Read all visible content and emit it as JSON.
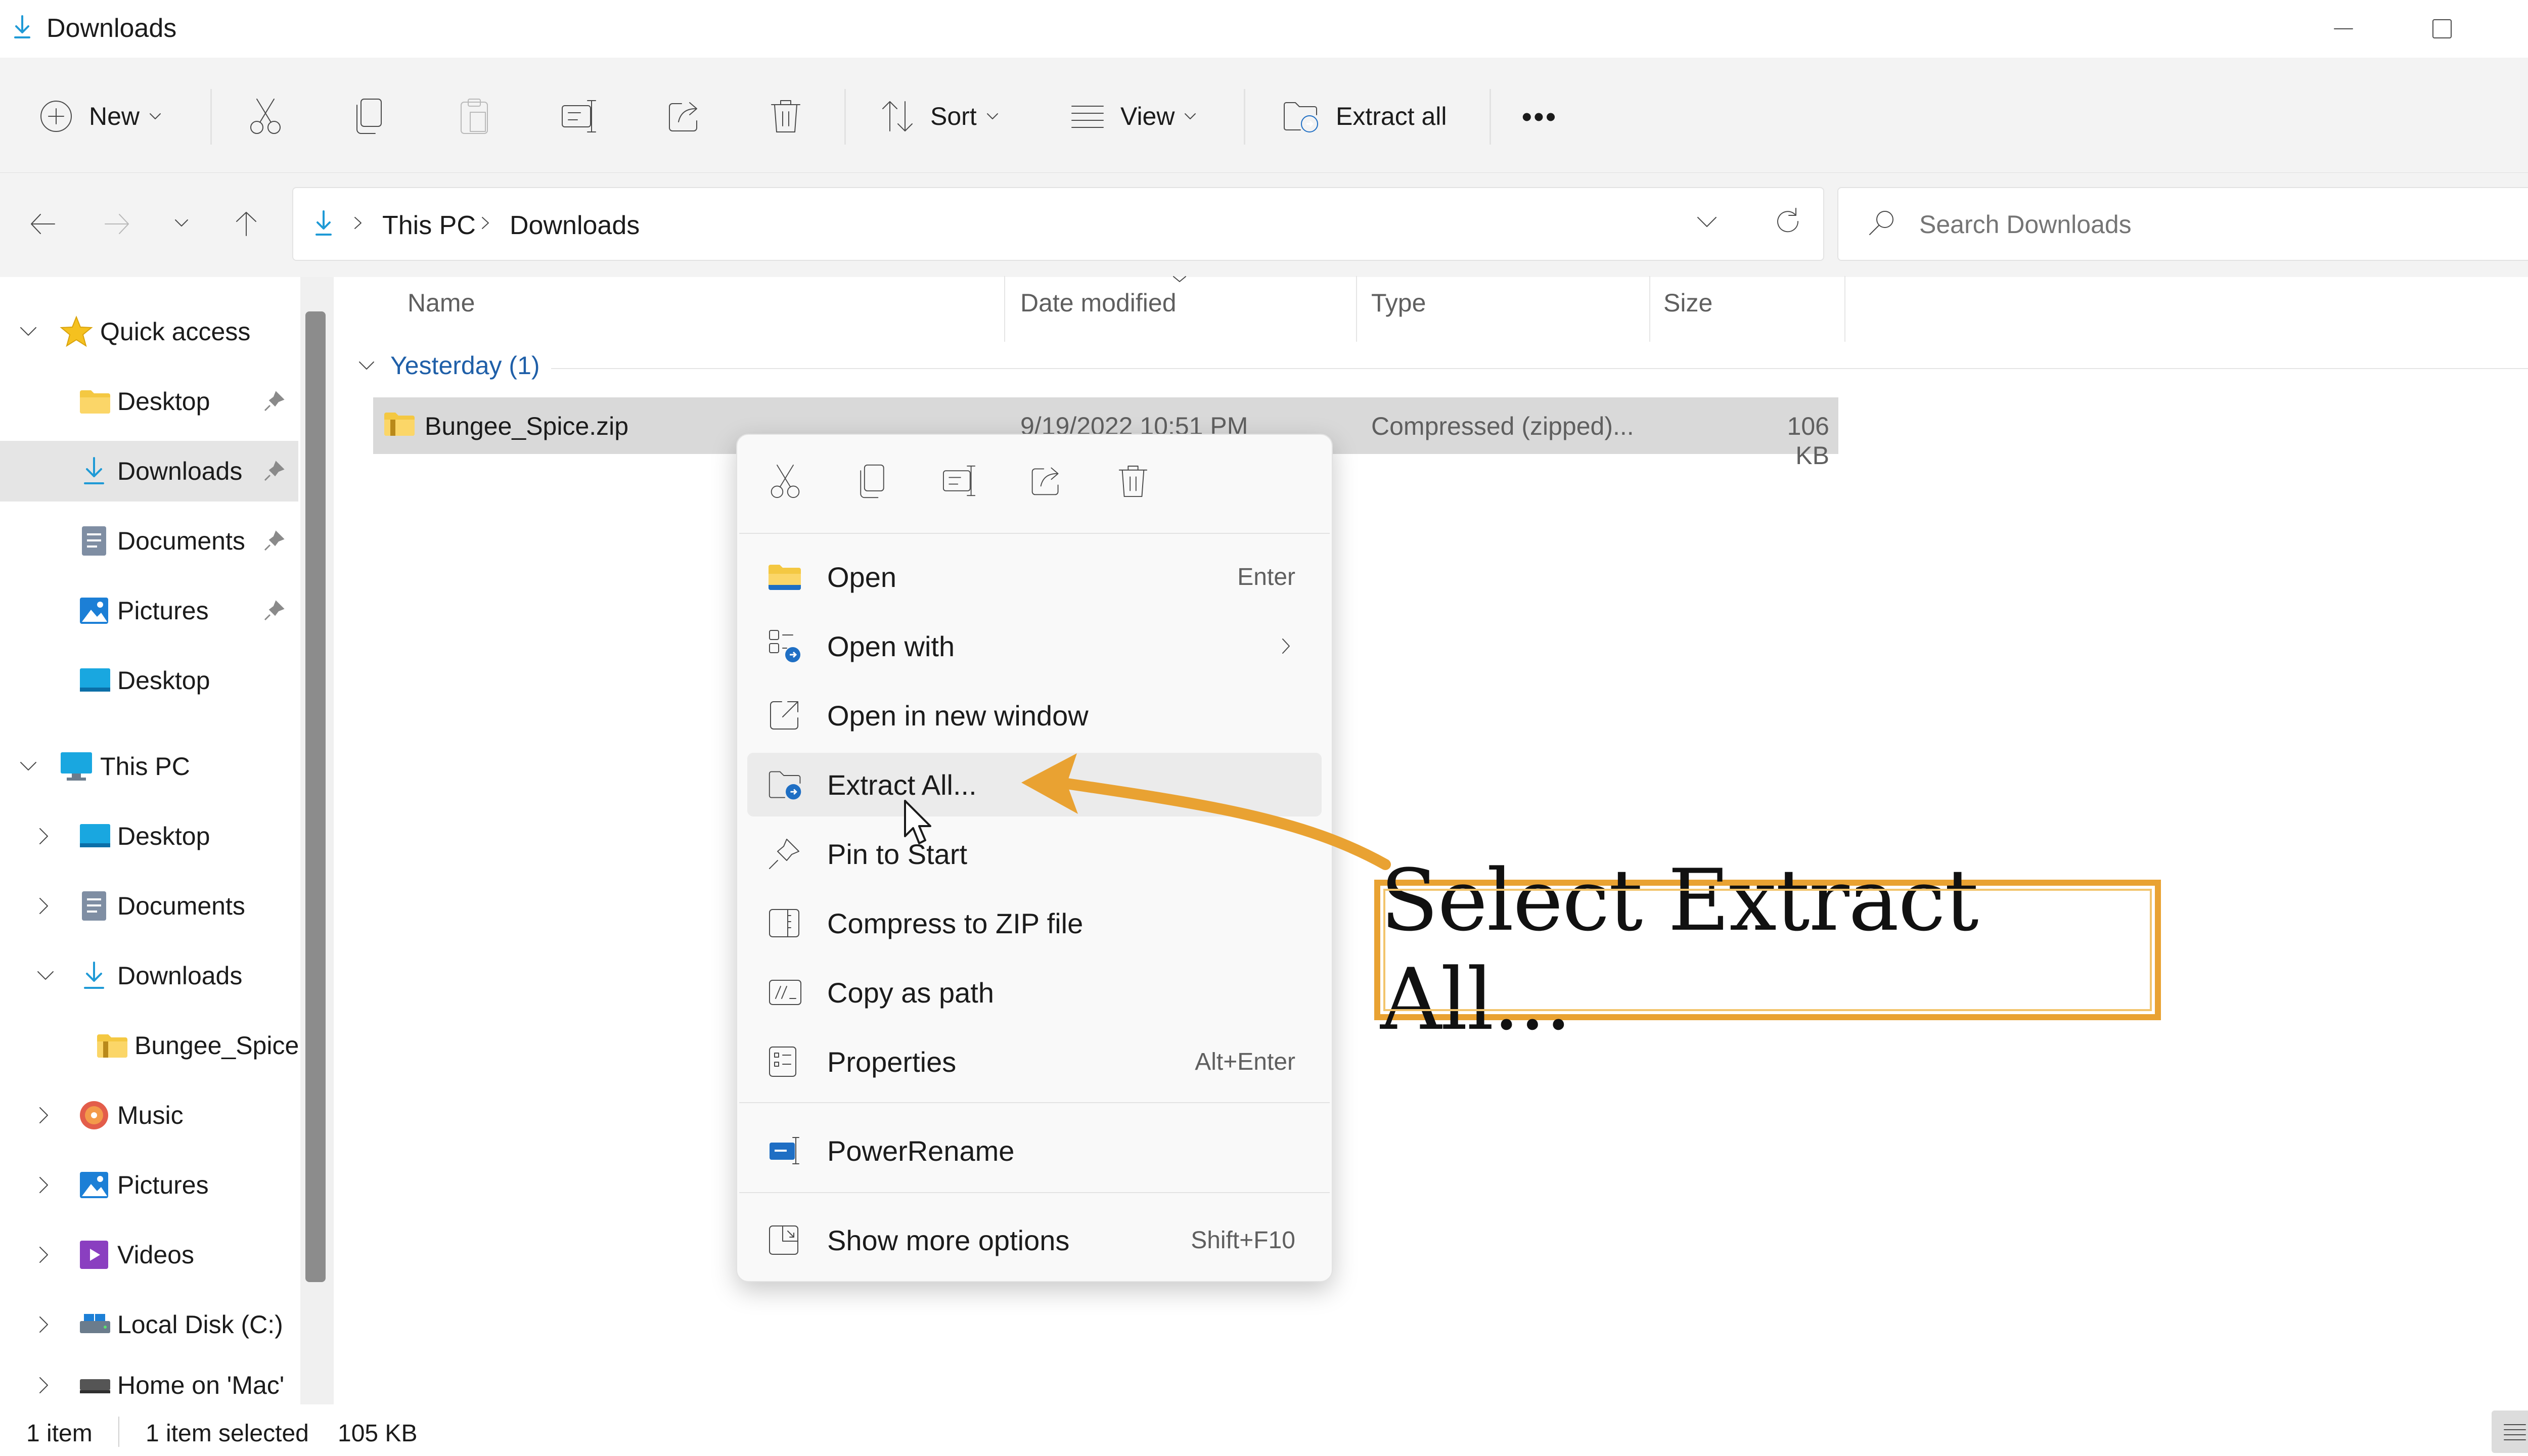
{
  "window": {
    "title": "Downloads"
  },
  "toolbar": {
    "new_label": "New",
    "sort_label": "Sort",
    "view_label": "View",
    "extract_all_label": "Extract all",
    "more_label": "•••"
  },
  "address": {
    "crumbs": [
      "This PC",
      "Downloads"
    ],
    "search_placeholder": "Search Downloads"
  },
  "sidebar": {
    "quick_access": "Quick access",
    "qa_items": [
      "Desktop",
      "Downloads",
      "Documents",
      "Pictures",
      "Desktop"
    ],
    "this_pc": "This PC",
    "pc_items": [
      "Desktop",
      "Documents",
      "Downloads",
      "Bungee_Spice",
      "Music",
      "Pictures",
      "Videos",
      "Local Disk (C:)",
      "Home on 'Mac'"
    ]
  },
  "filelist": {
    "columns": [
      "Name",
      "Date modified",
      "Type",
      "Size"
    ],
    "group": "Yesterday (1)",
    "file": {
      "name": "Bungee_Spice.zip",
      "date": "9/19/2022 10:51 PM",
      "type": "Compressed (zipped)...",
      "size": "106 KB"
    }
  },
  "status": {
    "count": "1 item",
    "selected": "1 item selected",
    "size": "105 KB"
  },
  "context_menu": {
    "items": [
      {
        "label": "Open",
        "shortcut": "Enter"
      },
      {
        "label": "Open with",
        "shortcut": ""
      },
      {
        "label": "Open in new window",
        "shortcut": ""
      },
      {
        "label": "Extract All...",
        "shortcut": ""
      },
      {
        "label": "Pin to Start",
        "shortcut": ""
      },
      {
        "label": "Compress to ZIP file",
        "shortcut": ""
      },
      {
        "label": "Copy as path",
        "shortcut": ""
      },
      {
        "label": "Properties",
        "shortcut": "Alt+Enter"
      },
      {
        "label": "PowerRename",
        "shortcut": ""
      },
      {
        "label": "Show more options",
        "shortcut": "Shift+F10"
      }
    ]
  },
  "callout": {
    "text": "Select Extract All..."
  },
  "colors": {
    "accent": "#1f6fc4",
    "callout_border": "#e9a232",
    "folder": "#f4c842",
    "selection": "#d9d9d9"
  }
}
